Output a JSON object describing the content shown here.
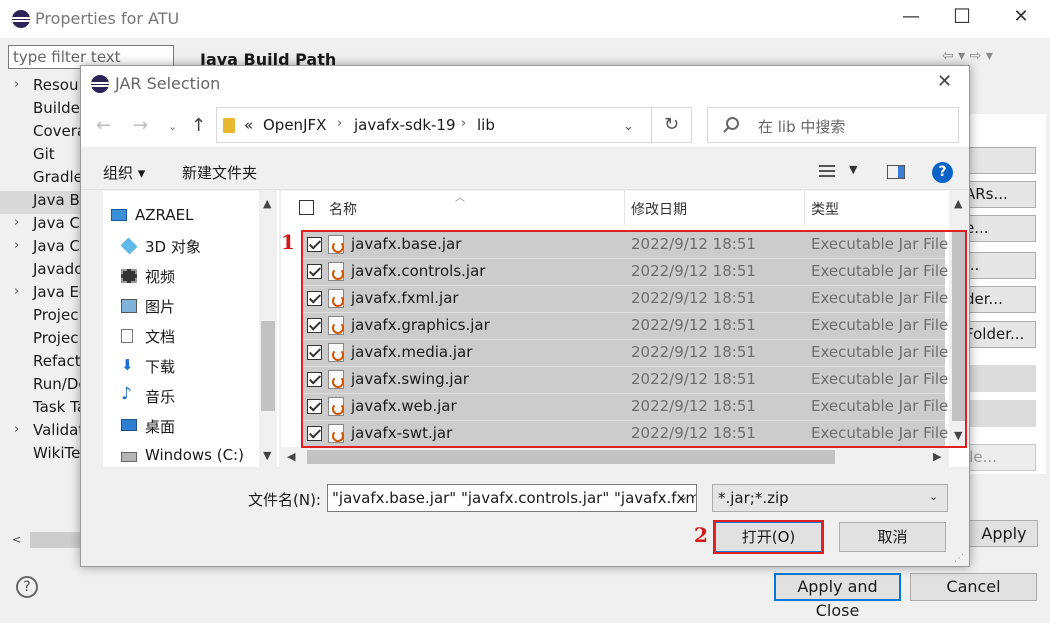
{
  "bg_window": {
    "title": "Properties for ATU",
    "filter_placeholder": "type filter text",
    "section_title": "Java Build Path",
    "nav_items": [
      {
        "label": "Resou",
        "expandable": true
      },
      {
        "label": "Builde",
        "expandable": false
      },
      {
        "label": "Covera",
        "expandable": false
      },
      {
        "label": "Git",
        "expandable": false
      },
      {
        "label": "Gradle",
        "expandable": false
      },
      {
        "label": "Java Bu",
        "expandable": false,
        "selected": true
      },
      {
        "label": "Java Co",
        "expandable": true
      },
      {
        "label": "Java Co",
        "expandable": true
      },
      {
        "label": "Javado",
        "expandable": false
      },
      {
        "label": "Java Ec",
        "expandable": true
      },
      {
        "label": "Projec",
        "expandable": false
      },
      {
        "label": "Projec",
        "expandable": false
      },
      {
        "label": "Refact",
        "expandable": false
      },
      {
        "label": "Run/De",
        "expandable": false
      },
      {
        "label": "Task Ta",
        "expandable": false
      },
      {
        "label": "Validat",
        "expandable": true
      },
      {
        "label": "WikiTe",
        "expandable": false
      }
    ],
    "right_buttons": [
      "",
      "ARs...",
      "e...",
      "...",
      "der...",
      " Folder...",
      "",
      "",
      "ile..."
    ],
    "apply_label": "Apply",
    "apply_close_label": "Apply and Close",
    "cancel_label": "Cancel"
  },
  "dialog": {
    "title": "JAR Selection",
    "breadcrumb": [
      "«",
      "OpenJFX",
      "javafx-sdk-19",
      "lib"
    ],
    "search_placeholder": "在 lib 中搜索",
    "organize_label": "组织 ▾",
    "new_folder_label": "新建文件夹",
    "tree": [
      {
        "label": "AZRAEL",
        "icon": "computer-icon"
      },
      {
        "label": "3D 对象",
        "icon": "cube-icon"
      },
      {
        "label": "视频",
        "icon": "film-icon"
      },
      {
        "label": "图片",
        "icon": "picture-icon"
      },
      {
        "label": "文档",
        "icon": "document-icon"
      },
      {
        "label": "下载",
        "icon": "download-icon"
      },
      {
        "label": "音乐",
        "icon": "music-icon"
      },
      {
        "label": "桌面",
        "icon": "desktop-icon"
      },
      {
        "label": "Windows (C:)",
        "icon": "drive-icon"
      }
    ],
    "columns": [
      "名称",
      "修改日期",
      "类型"
    ],
    "files": [
      {
        "name": "javafx.base.jar",
        "date": "2022/9/12 18:51",
        "type": "Executable Jar File"
      },
      {
        "name": "javafx.controls.jar",
        "date": "2022/9/12 18:51",
        "type": "Executable Jar File"
      },
      {
        "name": "javafx.fxml.jar",
        "date": "2022/9/12 18:51",
        "type": "Executable Jar File"
      },
      {
        "name": "javafx.graphics.jar",
        "date": "2022/9/12 18:51",
        "type": "Executable Jar File"
      },
      {
        "name": "javafx.media.jar",
        "date": "2022/9/12 18:51",
        "type": "Executable Jar File"
      },
      {
        "name": "javafx.swing.jar",
        "date": "2022/9/12 18:51",
        "type": "Executable Jar File"
      },
      {
        "name": "javafx.web.jar",
        "date": "2022/9/12 18:51",
        "type": "Executable Jar File"
      },
      {
        "name": "javafx-swt.jar",
        "date": "2022/9/12 18:51",
        "type": "Executable Jar File"
      }
    ],
    "filename_label": "文件名(N):",
    "filename_value": "\"javafx.base.jar\" \"javafx.controls.jar\" \"javafx.fxm",
    "filetype_value": "*.jar;*.zip",
    "open_label": "打开(O)",
    "cancel_label": "取消",
    "annotation_1": "1",
    "annotation_2": "2"
  },
  "colors": {
    "selection": "#cccccc",
    "annotation": "#e02020",
    "accent": "#0078d7"
  }
}
